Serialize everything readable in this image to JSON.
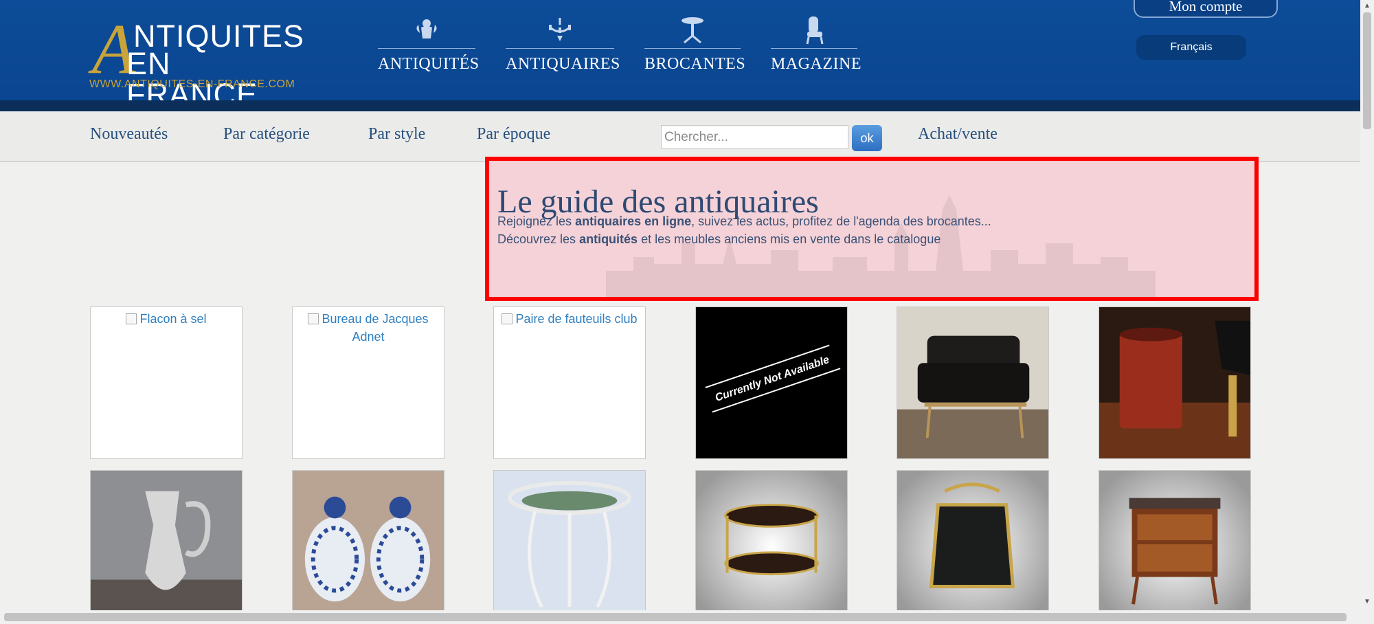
{
  "logo": {
    "big_letter": "A",
    "line1": "NTIQUITES",
    "line2": "EN FRANCE",
    "url": "WWW.ANTIQUITES-EN-FRANCE.COM"
  },
  "header": {
    "nav": [
      {
        "label": "ANTIQUITÉS",
        "icon": "cherub-icon"
      },
      {
        "label": "ANTIQUAIRES",
        "icon": "chandelier-icon"
      },
      {
        "label": "BROCANTES",
        "icon": "pedestal-table-icon"
      },
      {
        "label": "MAGAZINE",
        "icon": "armchair-icon"
      }
    ],
    "account_label": "Mon compte",
    "language_label": "Français"
  },
  "subnav": {
    "links": [
      "Nouveautés",
      "Par catégorie",
      "Par style",
      "Par époque"
    ],
    "search_placeholder": "Chercher...",
    "ok_label": "ok",
    "buy_sell_label": "Achat/vente"
  },
  "hero": {
    "title": "Le guide des antiquaires",
    "line1_pre": "Rejoignez les ",
    "line1_bold": "antiquaires en ligne",
    "line1_post": ", suivez les actus, profitez de l'agenda des brocantes...",
    "line2_pre": "Découvrez les ",
    "line2_bold": "antiquités",
    "line2_post": " et les meubles anciens mis en vente dans le catalogue"
  },
  "products": {
    "row1": [
      {
        "alt": "Flacon à sel",
        "type": "broken"
      },
      {
        "alt": "Bureau de Jacques Adnet",
        "type": "broken"
      },
      {
        "alt": "Paire de fauteuils club",
        "type": "broken"
      },
      {
        "type": "unavailable",
        "text": "Currently Not Available"
      },
      {
        "type": "photo",
        "subject": "leather-sofa"
      },
      {
        "type": "photo",
        "subject": "red-umbrella-stand"
      }
    ],
    "row2": [
      {
        "type": "photo",
        "subject": "crystal-ewer"
      },
      {
        "type": "photo",
        "subject": "delft-vases"
      },
      {
        "type": "photo",
        "subject": "wire-jardiniere"
      },
      {
        "type": "photo",
        "subject": "serving-trolley"
      },
      {
        "type": "photo",
        "subject": "magazine-rack"
      },
      {
        "type": "photo",
        "subject": "commode"
      }
    ]
  }
}
